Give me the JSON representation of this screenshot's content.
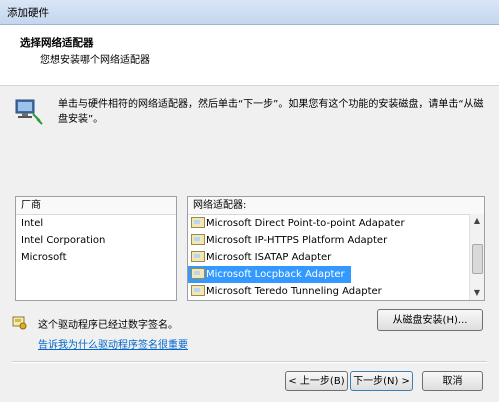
{
  "window": {
    "title": "添加硬件"
  },
  "header": {
    "title": "选择网络适配器",
    "subtitle": "您想安装哪个网络适配器"
  },
  "instructions": "单击与硬件相符的网络适配器，然后单击“下一步”。如果您有这个功能的安装磁盘，请单击“从磁盘安装”。",
  "manufacturers": {
    "header": "厂商",
    "items": [
      "Intel",
      "Intel Corporation",
      "Microsoft"
    ]
  },
  "adapters": {
    "header": "网络适配器:",
    "items": [
      "Microsoft Direct Point-to-point Adapater",
      "Microsoft IP-HTTPS Platform Adapter",
      "Microsoft ISATAP Adapter",
      "Microsoft Locpback Adapter",
      "Microsoft Teredo Tunneling Adapter"
    ],
    "selected_index": 3
  },
  "signature_text": "这个驱动程序已经过数字签名。",
  "link_text": "告诉我为什么驱动程序签名很重要",
  "buttons": {
    "have_disk": "从磁盘安装(H)...",
    "back": "< 上一步(B)",
    "next": "下一步(N) >",
    "cancel": "取消"
  },
  "colors": {
    "selection": "#3399ff",
    "link": "#0066cc",
    "header_bg": "#ffffff"
  }
}
